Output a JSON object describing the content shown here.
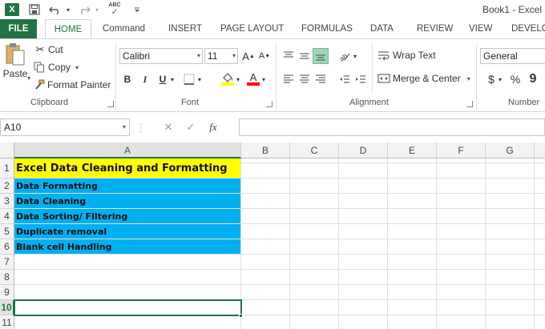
{
  "window": {
    "title": "Book1 - Excel"
  },
  "quick_access": {
    "logo_text": "X",
    "abc_label": "ABC"
  },
  "tabs": [
    {
      "label": "FILE"
    },
    {
      "label": "HOME",
      "active": true
    },
    {
      "label": "Command"
    },
    {
      "label": "INSERT"
    },
    {
      "label": "PAGE LAYOUT"
    },
    {
      "label": "FORMULAS"
    },
    {
      "label": "DATA"
    },
    {
      "label": "REVIEW"
    },
    {
      "label": "VIEW"
    },
    {
      "label": "DEVELO"
    }
  ],
  "ribbon": {
    "clipboard": {
      "paste_label": "Paste",
      "cut_label": "Cut",
      "copy_label": "Copy",
      "format_painter_label": "Format Painter",
      "group_label": "Clipboard"
    },
    "font": {
      "font_name": "Calibri",
      "font_size": "11",
      "grow_label": "A",
      "shrink_label": "A",
      "bold_label": "B",
      "italic_label": "I",
      "underline_label": "U",
      "font_color_label": "A",
      "group_label": "Font",
      "fill_color": "#ffff00",
      "text_color": "#ff0000"
    },
    "alignment": {
      "wrap_text_label": "Wrap Text",
      "merge_center_label": "Merge & Center",
      "group_label": "Alignment"
    },
    "number": {
      "format_value": "General",
      "currency_label": "$",
      "percent_label": "%",
      "comma_label": "9",
      "group_label": "Number"
    }
  },
  "formula_bar": {
    "name_box": "A10",
    "cancel_icon": "✕",
    "enter_icon": "✓",
    "fx_label": "fx",
    "formula_value": ""
  },
  "sheet": {
    "columns": [
      "A",
      "B",
      "C",
      "D",
      "E",
      "F",
      "G"
    ],
    "rows": [
      "1",
      "2",
      "3",
      "4",
      "5",
      "6",
      "7",
      "8",
      "9",
      "10",
      "11"
    ],
    "selected_cell": "A10",
    "cells": {
      "A1": "Excel Data Cleaning and Formatting",
      "A2": "Data Formatting",
      "A3": "Data Cleaning",
      "A4": "Data Sorting/ Filtering",
      "A5": "Duplicate removal",
      "A6": "Blank cell Handling"
    },
    "colors": {
      "title_fill": "#ffff00",
      "list_fill": "#00b0f0",
      "accent": "#217346"
    }
  }
}
